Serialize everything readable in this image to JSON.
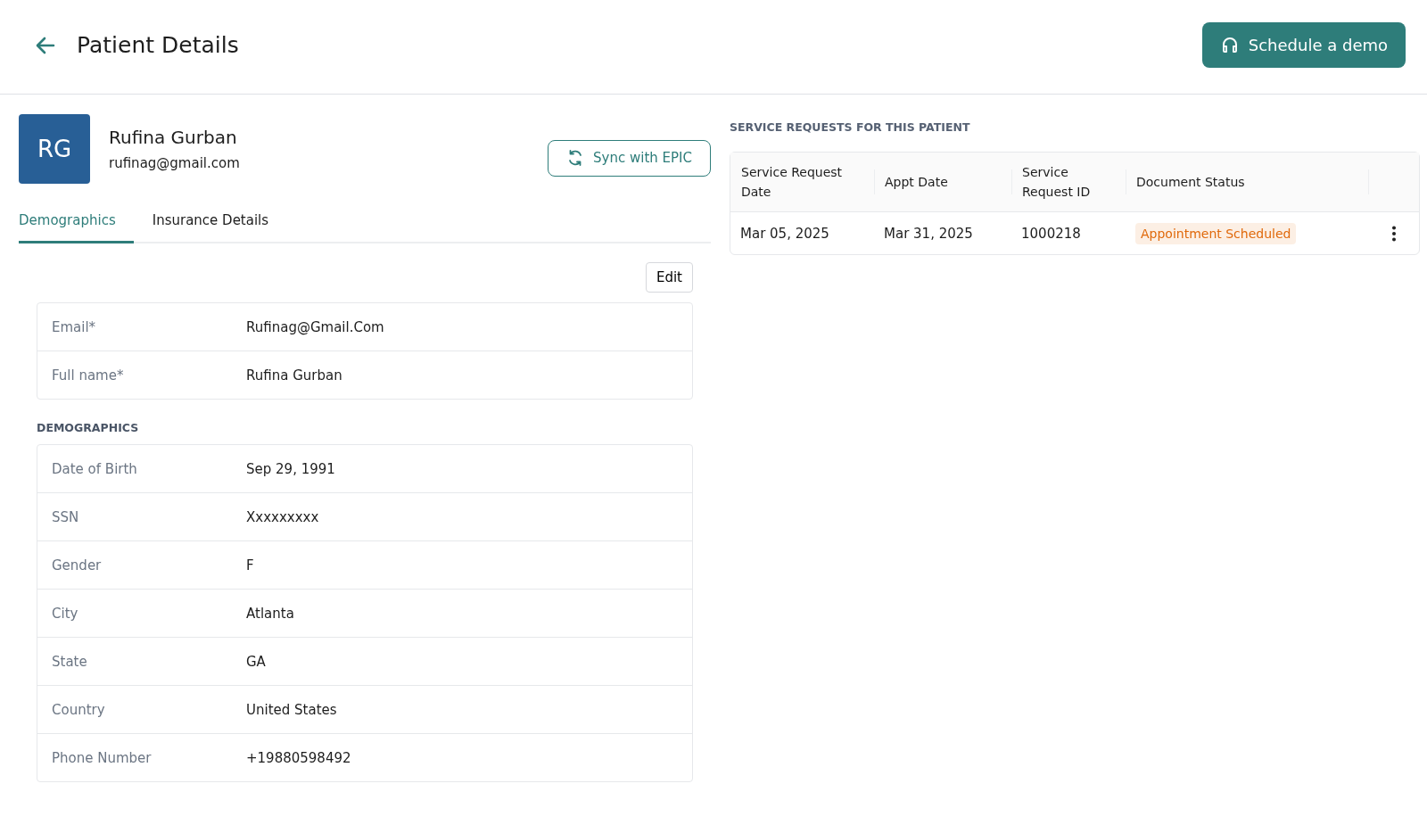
{
  "header": {
    "title": "Patient Details",
    "demo_button": "Schedule a demo"
  },
  "patient": {
    "initials": "RG",
    "name": "Rufina Gurban",
    "email": "rufinag@gmail.com",
    "sync_button": "Sync with EPIC"
  },
  "tabs": [
    {
      "label": "Demographics",
      "selected": true
    },
    {
      "label": "Insurance Details",
      "selected": false
    }
  ],
  "edit_button": "Edit",
  "account_fields": [
    {
      "label": "Email*",
      "value": "Rufinag@Gmail.Com"
    },
    {
      "label": "Full name*",
      "value": "Rufina Gurban"
    }
  ],
  "demographics": {
    "heading": "DEMOGRAPHICS",
    "fields": [
      {
        "label": "Date of Birth",
        "value": "Sep 29, 1991"
      },
      {
        "label": "SSN",
        "value": "Xxxxxxxxx"
      },
      {
        "label": "Gender",
        "value": "F"
      },
      {
        "label": "City",
        "value": "Atlanta"
      },
      {
        "label": "State",
        "value": "GA"
      },
      {
        "label": "Country",
        "value": "United States"
      },
      {
        "label": "Phone Number",
        "value": "+19880598492"
      }
    ]
  },
  "service_requests": {
    "heading": "SERVICE REQUESTS FOR THIS PATIENT",
    "columns": [
      "Service Request Date",
      "Appt Date",
      "Service Request ID",
      "Document Status"
    ],
    "rows": [
      {
        "request_date": "Mar 05, 2025",
        "appt_date": "Mar 31, 2025",
        "request_id": "1000218",
        "status": "Appointment Scheduled",
        "color": "#e0690b"
      }
    ]
  }
}
